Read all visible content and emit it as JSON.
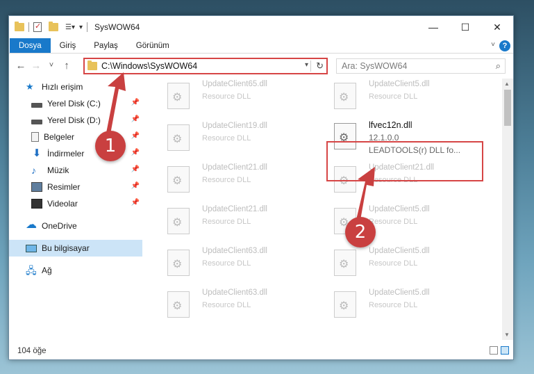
{
  "window": {
    "title": "SysWOW64"
  },
  "window_controls": {
    "minimize": "—",
    "maximize": "☐",
    "close": "✕"
  },
  "ribbon": {
    "tabs": [
      "Dosya",
      "Giriş",
      "Paylaş",
      "Görünüm"
    ],
    "help": "?"
  },
  "nav": {
    "back": "←",
    "forward": "→",
    "recent": "˅",
    "up": "↑"
  },
  "address": {
    "path": "C:\\Windows\\SysWOW64"
  },
  "search": {
    "placeholder": "Ara: SysWOW64",
    "icon": "search-icon"
  },
  "sidebar": {
    "items": [
      {
        "label": "Hızlı erişim",
        "icon": "star-icon",
        "pinned": false
      },
      {
        "label": "Yerel Disk (C:)",
        "icon": "disk-icon",
        "pinned": true
      },
      {
        "label": "Yerel Disk (D:)",
        "icon": "disk-icon",
        "pinned": true
      },
      {
        "label": "Belgeler",
        "icon": "document-icon",
        "pinned": true
      },
      {
        "label": "İndirmeler",
        "icon": "download-icon",
        "pinned": true
      },
      {
        "label": "Müzik",
        "icon": "music-icon",
        "pinned": true
      },
      {
        "label": "Resimler",
        "icon": "pictures-icon",
        "pinned": true
      },
      {
        "label": "Videolar",
        "icon": "video-icon",
        "pinned": true
      },
      {
        "label": "OneDrive",
        "icon": "cloud-icon",
        "pinned": false
      },
      {
        "label": "Bu bilgisayar",
        "icon": "computer-icon",
        "pinned": false,
        "selected": true
      },
      {
        "label": "Ağ",
        "icon": "network-icon",
        "pinned": false
      }
    ]
  },
  "files": [
    {
      "name": "UpdateClient65.dll",
      "type": "Resource DLL"
    },
    {
      "name": "UpdateClient5.dll",
      "type": "Resource DLL"
    },
    {
      "name": "UpdateClient19.dll",
      "type": "Resource DLL"
    },
    {
      "name": "lfvec12n.dll",
      "version": "12.1.0.0",
      "type": "LEADTOOLS(r) DLL fo...",
      "highlighted": true
    },
    {
      "name": "UpdateClient21.dll",
      "type": "Resource DLL"
    },
    {
      "name": "UpdateClient21.dll",
      "type": "Resource DLL"
    },
    {
      "name": "UpdateClient21.dll",
      "type": "Resource DLL"
    },
    {
      "name": "UpdateClient5.dll",
      "type": "Resource DLL"
    },
    {
      "name": "UpdateClient63.dll",
      "type": "Resource DLL"
    },
    {
      "name": "UpdateClient5.dll",
      "type": "Resource DLL"
    },
    {
      "name": "UpdateClient63.dll",
      "type": "Resource DLL"
    },
    {
      "name": "UpdateClient5.dll",
      "type": "Resource DLL"
    }
  ],
  "status": {
    "count": "104 öğe"
  },
  "annotations": {
    "step1": "1",
    "step2": "2",
    "color": "#c94040"
  }
}
